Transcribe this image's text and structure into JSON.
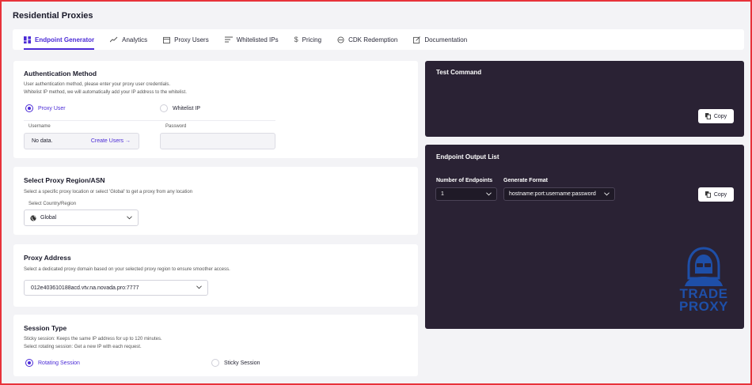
{
  "page": {
    "title": "Residential Proxies"
  },
  "tabs": [
    {
      "label": "Endpoint Generator",
      "icon": "grid-icon",
      "active": true
    },
    {
      "label": "Analytics",
      "icon": "trend-icon"
    },
    {
      "label": "Proxy Users",
      "icon": "calendar-icon"
    },
    {
      "label": "Whitelisted IPs",
      "icon": "list-icon"
    },
    {
      "label": "Pricing",
      "icon": "dollar-icon"
    },
    {
      "label": "CDK Redemption",
      "icon": "refresh-icon"
    },
    {
      "label": "Documentation",
      "icon": "edit-icon"
    }
  ],
  "auth": {
    "title": "Authentication Method",
    "desc1": "User authentication method, please enter your proxy user credentials.",
    "desc2": "Whitelist IP method, we will automatically add your IP address to the whitelist.",
    "option_proxy_user": "Proxy User",
    "option_whitelist": "Whitelist IP",
    "username_label": "Username",
    "username_value": "No data.",
    "create_users": "Create Users →",
    "password_label": "Password"
  },
  "region": {
    "title": "Select Proxy Region/ASN",
    "desc": "Select a specific proxy location or select 'Global' to get a proxy from any location",
    "country_label": "Select Country/Region",
    "country_value": "Global"
  },
  "address": {
    "title": "Proxy Address",
    "desc": "Select a dedicated proxy domain based on your selected proxy region to ensure smoother access.",
    "value": "012e403610188acd.vtv.na.novada.pro:7777"
  },
  "session": {
    "title": "Session Type",
    "desc1": "Sticky session: Keeps the same IP address for up to 120 minutes.",
    "desc2": "Select rotating session: Get a new IP with each request.",
    "option_rotating": "Rotating Session",
    "option_sticky": "Sticky Session"
  },
  "test_command": {
    "title": "Test Command",
    "copy_label": "Copy"
  },
  "output": {
    "title": "Endpoint Output List",
    "num_label": "Number of Endpoints",
    "num_value": "1",
    "format_label": "Generate Format",
    "format_value": "hostname:port:username:password",
    "copy_label": "Copy"
  },
  "watermark": {
    "line1": "TRADE",
    "line2": "PROXY"
  },
  "colors": {
    "accent": "#4b2bd6",
    "dark_panel": "#2a2234",
    "frame": "#e8323a",
    "logo": "#1e4fa8"
  }
}
